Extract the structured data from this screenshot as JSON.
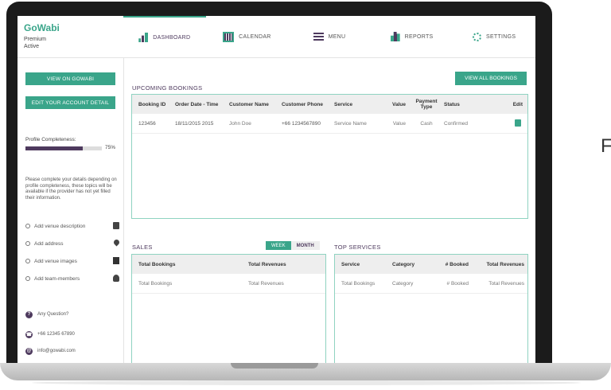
{
  "brand": {
    "logo": "GoWabi",
    "plan": "Premium",
    "status": "Active"
  },
  "nav": [
    {
      "label": "DASHBOARD",
      "icon": "dashboard-icon"
    },
    {
      "label": "CALENDAR",
      "icon": "calendar-icon"
    },
    {
      "label": "MENU",
      "icon": "menu-icon"
    },
    {
      "label": "REPORTS",
      "icon": "reports-icon"
    },
    {
      "label": "SETTINGS",
      "icon": "settings-icon"
    }
  ],
  "sidebar": {
    "view_btn": "VIEW ON GOWABI",
    "edit_btn": "EDIT YOUR ACCOUNT DETAIL",
    "profile_label": "Profile Completeness:",
    "profile_pct": "75%",
    "profile_value": 0.75,
    "note": "Please complete your details depending on profile completeness, these topics will be available if the provider has not yet filled their information.",
    "tasks": [
      {
        "label": "Add venue description",
        "icon": "calendar-icon"
      },
      {
        "label": "Add address",
        "icon": "map-pin-icon"
      },
      {
        "label": "Add venue images",
        "icon": "image-icon"
      },
      {
        "label": "Add team-members",
        "icon": "user-icon"
      }
    ],
    "help": [
      {
        "label": "Any Question?",
        "icon": "question-icon"
      },
      {
        "label": "+66 12345 67890",
        "icon": "phone-icon"
      },
      {
        "label": "info@gowabi.com",
        "icon": "email-icon"
      }
    ]
  },
  "upcoming": {
    "title": "UPCOMING BOOKINGS",
    "view_all": "VIEW ALL BOOKINGS",
    "columns": [
      "Booking ID",
      "Order Date - Time",
      "Customer Name",
      "Customer Phone",
      "Service",
      "Value",
      "Payment Type",
      "Status",
      "Edit"
    ],
    "rows": [
      [
        "123456",
        "18/11/2015 2015",
        "John Doe",
        "+66 1234567890",
        "Service Name",
        "Value",
        "Cash",
        "Confirmed"
      ]
    ]
  },
  "sales": {
    "title": "SALES",
    "toggle_week": "WEEK",
    "toggle_month": "MONTH",
    "columns": [
      "Total Bookings",
      "Total Revenues"
    ],
    "rows": [
      [
        "Total Bookings",
        "Total Revenues"
      ]
    ]
  },
  "top_services": {
    "title": "TOP SERVICES",
    "columns": [
      "Service",
      "Category",
      "# Booked",
      "Total Revenues"
    ],
    "rows": [
      [
        "Total Bookings",
        "Category",
        "# Booked",
        "Total Revenues"
      ]
    ]
  },
  "side_text": "F",
  "colors": {
    "accent": "#3aa58a",
    "brand_purple": "#4e3a5e",
    "panel_border": "#8fd3c1"
  }
}
